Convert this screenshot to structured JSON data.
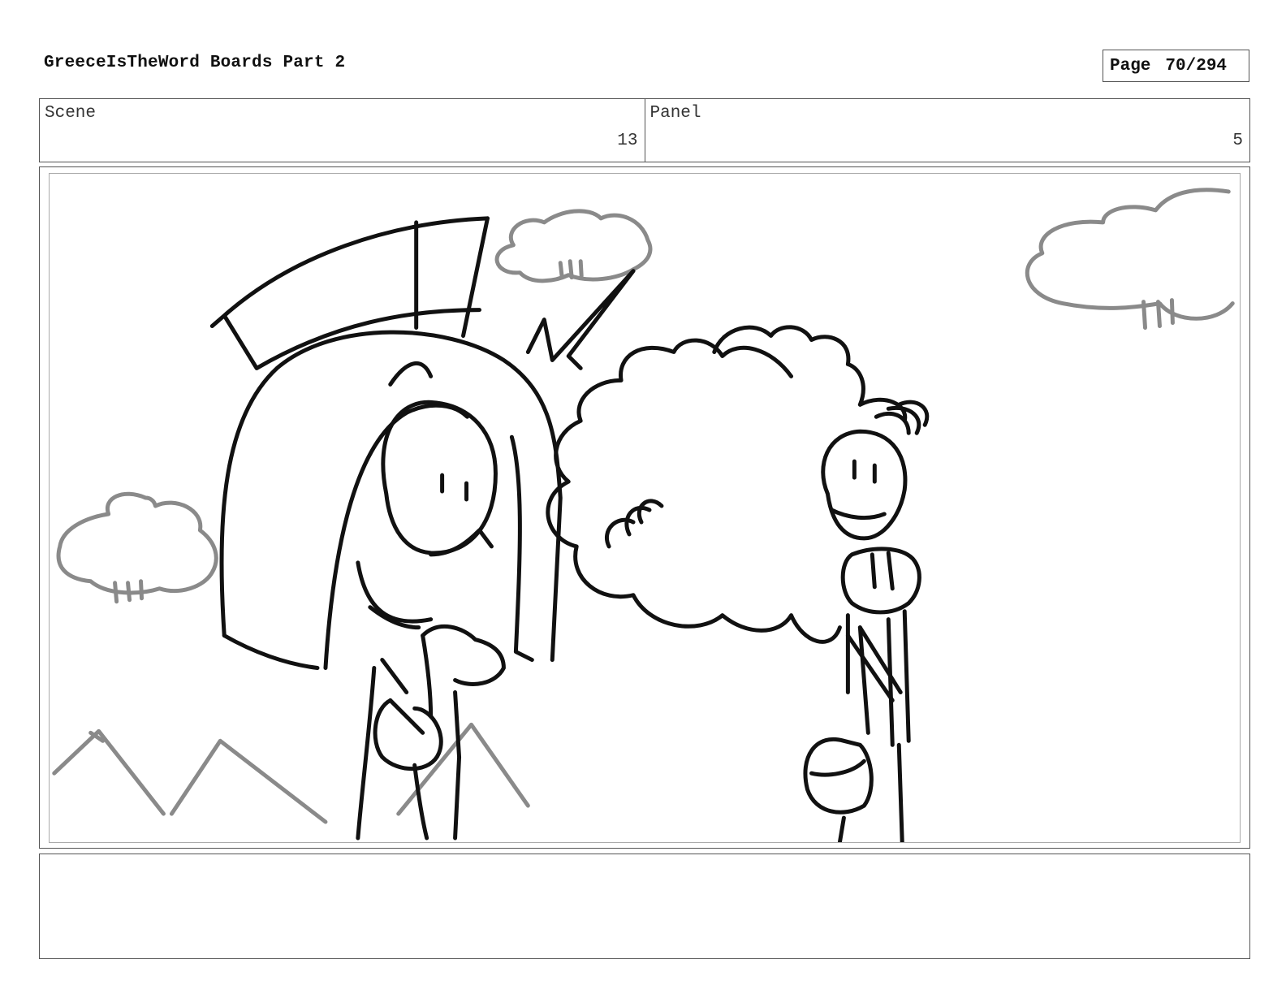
{
  "header": {
    "title": "GreeceIsTheWord Boards Part 2",
    "page_label": "Page",
    "page_value": "70/294"
  },
  "info": {
    "scene_label": "Scene",
    "scene_value": "13",
    "panel_label": "Panel",
    "panel_value": "5"
  },
  "notes": {
    "text": ""
  },
  "colors": {
    "ink": "#111111",
    "background_sketch": "#8a8a8a",
    "border": "#555555"
  }
}
